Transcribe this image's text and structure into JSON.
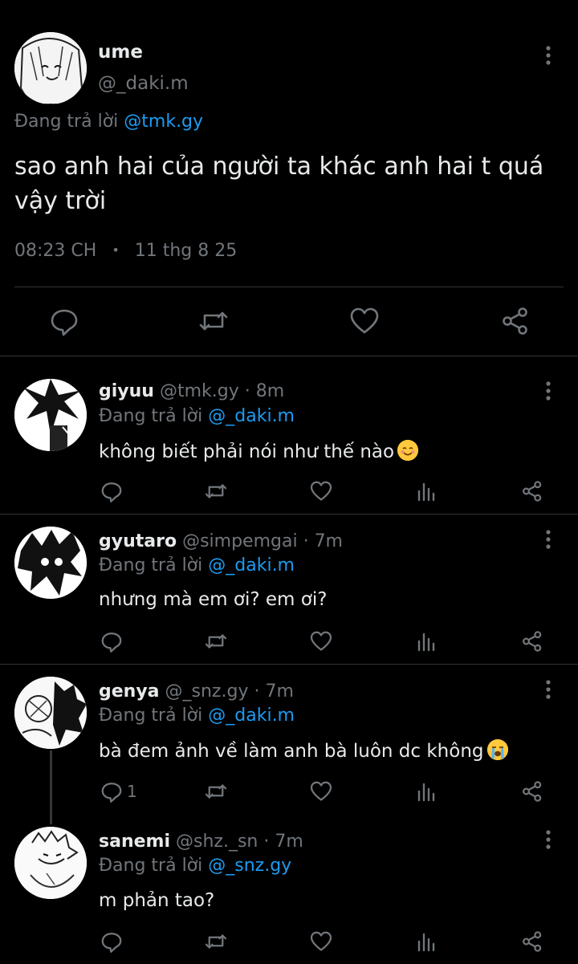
{
  "main_tweet": {
    "display_name": "ume",
    "handle": "@_daki.m",
    "reply_prefix": "Đang trả lời",
    "reply_to": "@tmk.gy",
    "text": "sao anh hai của người ta khác anh hai t quá vậy trời",
    "time": "08:23 CH",
    "dot": "•",
    "date": "11 thg 8 25",
    "actions": [
      "reply-icon",
      "retweet-icon",
      "like-icon",
      "share-icon"
    ]
  },
  "replies": [
    {
      "display_name": "giyuu",
      "handle": "@tmk.gy",
      "age": "· 8m",
      "reply_prefix": "Đang trả lời",
      "reply_to": "@_daki.m",
      "text": "không biết phải nói như thế nào",
      "emoji": "smiling-blush-emoji",
      "reply_count": ""
    },
    {
      "display_name": "gyutaro",
      "handle": "@simpemgai",
      "age": "· 7m",
      "reply_prefix": "Đang trả lời",
      "reply_to": "@_daki.m",
      "text": "nhưng mà em ơi? em ơi?",
      "reply_count": ""
    },
    {
      "display_name": "genya",
      "handle": "@_snz.gy",
      "age": "· 7m",
      "reply_prefix": "Đang trả lời",
      "reply_to": "@_daki.m",
      "text": "bà đem ảnh về làm anh bà luôn dc không",
      "emoji": "loudly-crying-emoji",
      "reply_count": "1"
    },
    {
      "display_name": "sanemi",
      "handle": "@shz._sn",
      "age": "· 7m",
      "reply_prefix": "Đang trả lời",
      "reply_to": "@_snz.gy",
      "text": "m phản tao?",
      "reply_count": ""
    }
  ],
  "colors": {
    "background": "#000000",
    "text": "#e7e9ea",
    "muted": "#71767b",
    "link": "#1d9bf0",
    "divider": "#2f3336"
  }
}
